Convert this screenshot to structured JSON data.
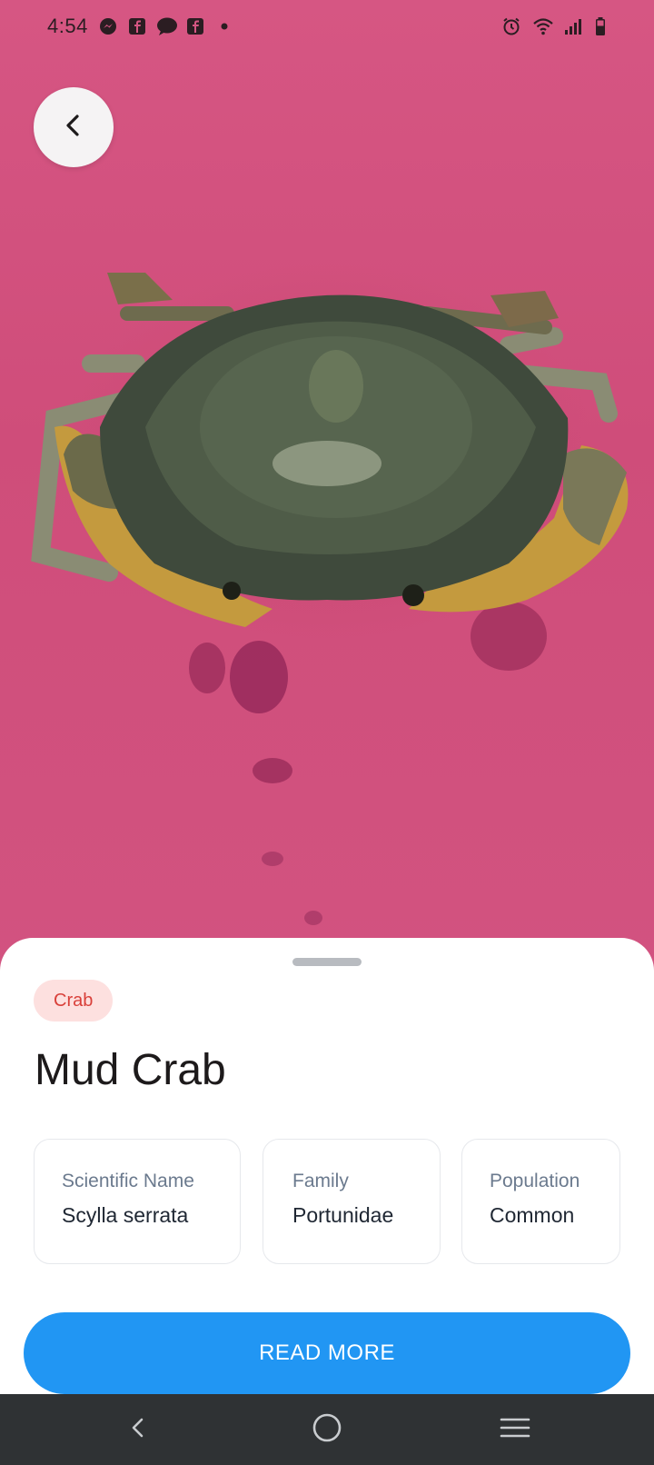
{
  "status_bar": {
    "time": "4:54",
    "left_icons": [
      "messenger-icon",
      "facebook-icon",
      "chat-icon",
      "facebook-icon",
      "dot-icon"
    ],
    "right_icons": [
      "alarm-icon",
      "wifi-icon",
      "signal-icon",
      "battery-icon"
    ]
  },
  "hero": {
    "image_subject": "mud crab on pink cloth"
  },
  "detail": {
    "category": "Crab",
    "title": "Mud Crab",
    "info": [
      {
        "label": "Scientific Name",
        "value": "Scylla serrata"
      },
      {
        "label": "Family",
        "value": "Portunidae"
      },
      {
        "label": "Population",
        "value": "Common"
      }
    ],
    "read_more_label": "READ MORE"
  },
  "colors": {
    "accent": "#2196f3",
    "chip_bg": "#fde0df",
    "chip_text": "#d9403a",
    "background_pink": "#d4507c",
    "nav_bar": "#2f3234"
  },
  "nav_bar": {
    "buttons": [
      "back-icon",
      "home-icon",
      "recents-icon"
    ]
  }
}
